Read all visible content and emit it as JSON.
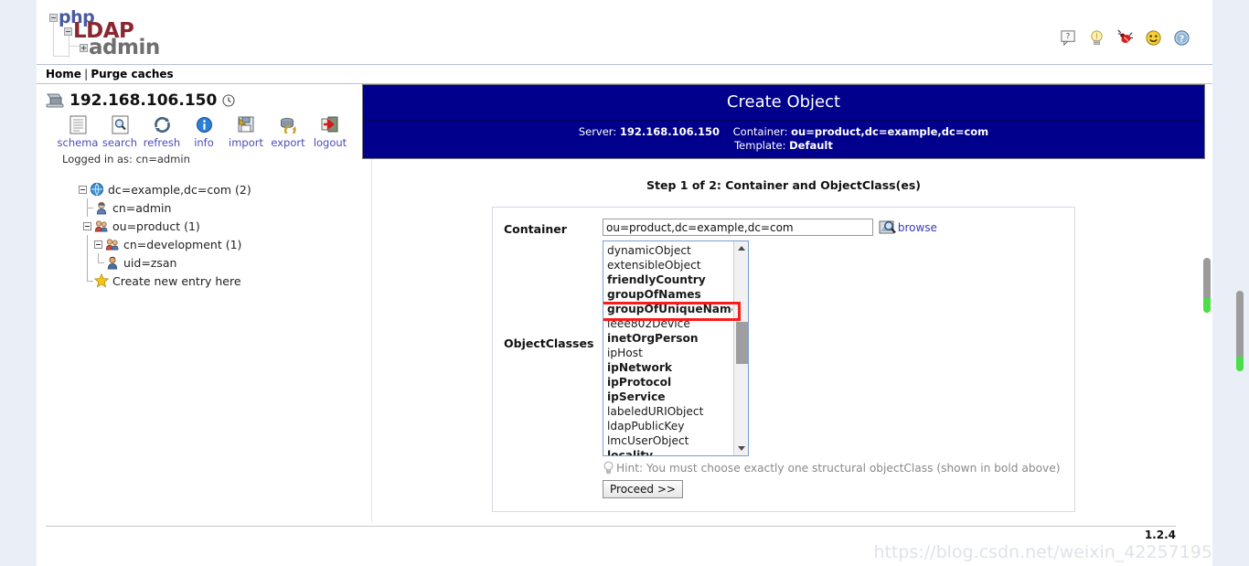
{
  "app": {
    "logo": {
      "php": "php",
      "ldap": "LDAP",
      "admin": "admin"
    },
    "version": "1.2.4",
    "watermark": "https://blog.csdn.net/weixin_42257195"
  },
  "header_icons": [
    {
      "name": "help-bubble-icon",
      "title": "?"
    },
    {
      "name": "lightbulb-icon",
      "title": "hints"
    },
    {
      "name": "bug-icon",
      "title": "report bug"
    },
    {
      "name": "smiley-icon",
      "title": "feedback"
    },
    {
      "name": "about-icon",
      "title": "about"
    }
  ],
  "navbar": {
    "home": "Home",
    "separator": "|",
    "purge": "Purge caches"
  },
  "sidebar": {
    "server": "192.168.106.150",
    "toolbar": [
      {
        "label": "schema",
        "icon": "schema-icon"
      },
      {
        "label": "search",
        "icon": "search-icon"
      },
      {
        "label": "refresh",
        "icon": "refresh-icon"
      },
      {
        "label": "info",
        "icon": "info-icon"
      },
      {
        "label": "import",
        "icon": "import-icon"
      },
      {
        "label": "export",
        "icon": "export-icon"
      },
      {
        "label": "logout",
        "icon": "logout-icon"
      }
    ],
    "logged_in_as": "Logged in as: cn=admin",
    "tree": [
      {
        "label": "dc=example,dc=com (2)",
        "icon": "globe-icon",
        "depth": 0,
        "expander": true
      },
      {
        "label": "cn=admin",
        "icon": "admin-user-icon",
        "depth": 1,
        "expander": false
      },
      {
        "label": "ou=product (1)",
        "icon": "group-icon",
        "depth": 1,
        "expander": true
      },
      {
        "label": "cn=development (1)",
        "icon": "group-icon",
        "depth": 2,
        "expander": true
      },
      {
        "label": "uid=zsan",
        "icon": "user-icon",
        "depth": 3,
        "expander": false
      },
      {
        "label": "Create new entry here",
        "icon": "star-icon",
        "depth": 1,
        "expander": false
      }
    ]
  },
  "main": {
    "title": "Create Object",
    "subtitle": {
      "server_label": "Server:",
      "server_value": "192.168.106.150",
      "container_label": "Container:",
      "container_value": "ou=product,dc=example,dc=com",
      "template_label": "Template:",
      "template_value": "Default"
    },
    "step_title": "Step 1 of 2: Container and ObjectClass(es)",
    "container": {
      "label": "Container",
      "value": "ou=product,dc=example,dc=com",
      "placeholder": "",
      "browse_label": "browse",
      "browse_icon": "browse-magnifier-icon"
    },
    "objectclasses": {
      "label": "ObjectClasses",
      "options": [
        {
          "name": "dynamicObject",
          "structural": false,
          "selected": false
        },
        {
          "name": "extensibleObject",
          "structural": false,
          "selected": false
        },
        {
          "name": "friendlyCountry",
          "structural": true,
          "selected": false
        },
        {
          "name": "groupOfNames",
          "structural": true,
          "selected": false
        },
        {
          "name": "groupOfUniqueNames",
          "structural": true,
          "selected": true
        },
        {
          "name": "ieee802Device",
          "structural": false,
          "selected": false
        },
        {
          "name": "inetOrgPerson",
          "structural": true,
          "selected": false
        },
        {
          "name": "ipHost",
          "structural": false,
          "selected": false
        },
        {
          "name": "ipNetwork",
          "structural": true,
          "selected": false
        },
        {
          "name": "ipProtocol",
          "structural": true,
          "selected": false
        },
        {
          "name": "ipService",
          "structural": true,
          "selected": false
        },
        {
          "name": "labeledURIObject",
          "structural": false,
          "selected": false
        },
        {
          "name": "ldapPublicKey",
          "structural": false,
          "selected": false
        },
        {
          "name": "lmcUserObject",
          "structural": false,
          "selected": false
        },
        {
          "name": "locality",
          "structural": true,
          "selected": false
        }
      ]
    },
    "hint": "Hint: You must choose exactly one structural objectClass (shown in bold above)",
    "proceed_label": "Proceed >>"
  },
  "colors": {
    "header_blue": "#00008c",
    "link": "#3a3ac0",
    "annotation_red": "#ff1a1a",
    "scrollbar_tip_green": "#4ade4a"
  }
}
